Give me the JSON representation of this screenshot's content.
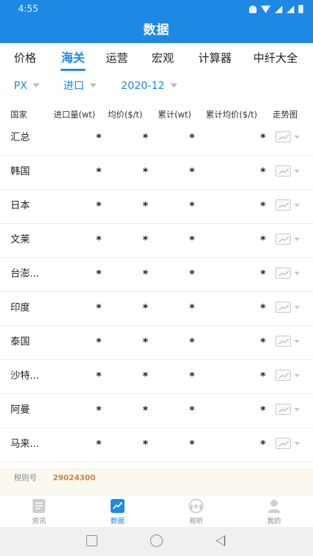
{
  "status_bar": {
    "time": "4:55"
  },
  "app_title": "数据",
  "tabs": [
    {
      "label": "价格",
      "active": false
    },
    {
      "label": "海关",
      "active": true
    },
    {
      "label": "运营",
      "active": false
    },
    {
      "label": "宏观",
      "active": false
    },
    {
      "label": "计算器",
      "active": false
    },
    {
      "label": "中纤大全",
      "active": false
    }
  ],
  "filters": {
    "product": "PX",
    "direction": "进口",
    "period": "2020-12"
  },
  "table": {
    "headers": [
      "国家",
      "进口量(wt)",
      "均价($/t)",
      "累计(wt)",
      "累计均价($/t)",
      "走势图"
    ],
    "rows": [
      {
        "country": "汇总",
        "import_qty": "*",
        "avg_price": "*",
        "cumulative": "*",
        "cumulative_avg": "*"
      },
      {
        "country": "韩国",
        "import_qty": "*",
        "avg_price": "*",
        "cumulative": "*",
        "cumulative_avg": "*"
      },
      {
        "country": "日本",
        "import_qty": "*",
        "avg_price": "*",
        "cumulative": "*",
        "cumulative_avg": "*"
      },
      {
        "country": "文莱",
        "import_qty": "*",
        "avg_price": "*",
        "cumulative": "*",
        "cumulative_avg": "*"
      },
      {
        "country": "台澎...",
        "import_qty": "*",
        "avg_price": "*",
        "cumulative": "*",
        "cumulative_avg": "*"
      },
      {
        "country": "印度",
        "import_qty": "*",
        "avg_price": "*",
        "cumulative": "*",
        "cumulative_avg": "*"
      },
      {
        "country": "泰国",
        "import_qty": "*",
        "avg_price": "*",
        "cumulative": "*",
        "cumulative_avg": "*"
      },
      {
        "country": "沙特...",
        "import_qty": "*",
        "avg_price": "*",
        "cumulative": "*",
        "cumulative_avg": "*"
      },
      {
        "country": "阿曼",
        "import_qty": "*",
        "avg_price": "*",
        "cumulative": "*",
        "cumulative_avg": "*"
      },
      {
        "country": "马来...",
        "import_qty": "*",
        "avg_price": "*",
        "cumulative": "*",
        "cumulative_avg": "*"
      }
    ]
  },
  "tax": {
    "label": "税则号",
    "value": "29024300"
  },
  "bottom_nav": [
    {
      "label": "资讯",
      "icon": "news-list-icon",
      "active": false
    },
    {
      "label": "数据",
      "icon": "trend-chart-icon",
      "active": true
    },
    {
      "label": "视听",
      "icon": "video-play-icon",
      "active": false
    },
    {
      "label": "我的",
      "icon": "profile-person-icon",
      "active": false
    }
  ],
  "colors": {
    "primary": "#1e88e5",
    "tax_value": "#c9883a",
    "tax_bar_bg": "#fbf8f0",
    "inactive_nav": "#8d8d8d"
  }
}
